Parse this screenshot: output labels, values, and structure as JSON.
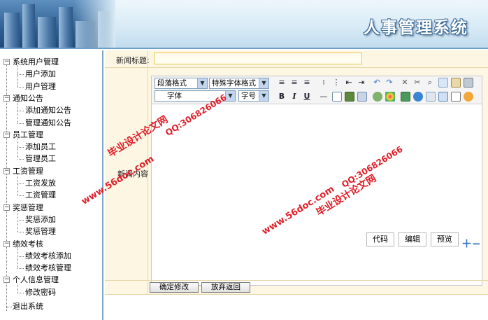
{
  "header": {
    "title": "人事管理系统"
  },
  "sidebar": {
    "groups": [
      {
        "label": "系统用户管理",
        "items": [
          "用户添加",
          "用户管理"
        ]
      },
      {
        "label": "通知公告",
        "items": [
          "添加通知公告",
          "管理通知公告"
        ]
      },
      {
        "label": "员工管理",
        "items": [
          "添加员工",
          "管理员工"
        ]
      },
      {
        "label": "工资管理",
        "items": [
          "工资发放",
          "工资管理"
        ]
      },
      {
        "label": "奖惩管理",
        "items": [
          "奖惩添加",
          "奖惩管理"
        ]
      },
      {
        "label": "绩效考核",
        "items": [
          "绩效考核添加",
          "绩效考核管理"
        ]
      },
      {
        "label": "个人信息管理",
        "items": [
          "修改密码"
        ]
      }
    ],
    "exit": "退出系统"
  },
  "form": {
    "title_label": "新闻标题:",
    "title_value": "",
    "content_label": "新闻内容"
  },
  "editor": {
    "paragraph_format": "段落格式",
    "special_format": "特殊字体格式",
    "font_family": "字体",
    "font_size": "字号",
    "bold": "B",
    "italic": "I",
    "underline": "U",
    "modes": [
      "代码",
      "编辑",
      "预览"
    ]
  },
  "buttons": {
    "submit": "确定修改",
    "cancel": "放弃返回"
  },
  "watermarks": {
    "site": "www.56doc.com",
    "qq": "QQ:306826066",
    "name": "毕业设计论文网"
  },
  "colors": {
    "accent": "#6f9fc6",
    "main_bg": "#fdf6e3",
    "watermark": "#e0202a"
  }
}
